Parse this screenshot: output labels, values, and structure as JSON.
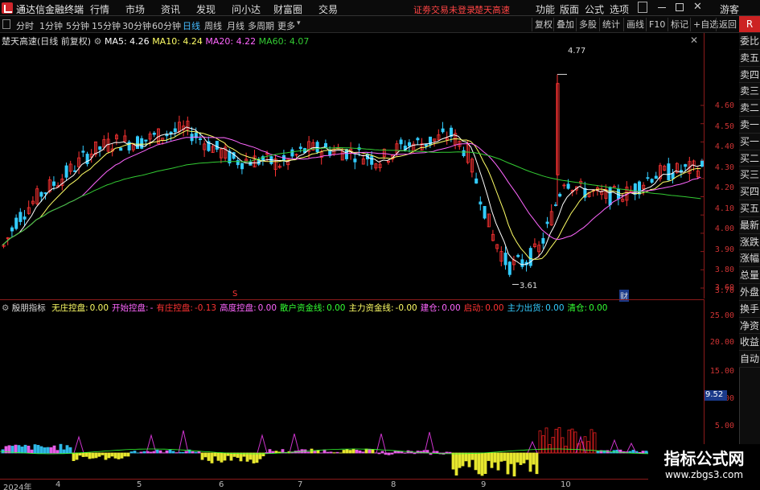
{
  "app": {
    "title": "通达信金融终端",
    "status_text": "证劵交易未登录",
    "stock_name_header": "楚天高速",
    "guest_label": "游客"
  },
  "menu": [
    "行情",
    "市场",
    "资讯",
    "发现",
    "问小达",
    "财富圈",
    "交易"
  ],
  "top_right_menu": [
    "功能",
    "版面",
    "公式",
    "选项"
  ],
  "periods": [
    "分时",
    "1分钟",
    "5分钟",
    "15分钟",
    "30分钟",
    "60分钟",
    "日线",
    "周线",
    "月线",
    "多周期",
    "更多"
  ],
  "active_period": "日线",
  "toolbar_right": [
    "复权",
    "叠加",
    "多股",
    "统计",
    "画线",
    "F10",
    "标记",
    "+自选",
    "返回"
  ],
  "main_legend": {
    "title": "楚天高速(日线 前复权)",
    "ma5": "MA5: 4.26",
    "ma10": "MA10: 4.24",
    "ma20": "MA20: 4.22",
    "ma60": "MA60: 4.07"
  },
  "price_axis": [
    "4.60",
    "4.50",
    "4.40",
    "4.30",
    "4.20",
    "4.10",
    "4.00",
    "3.90",
    "3.80",
    "3.70",
    "3.60"
  ],
  "annotations": {
    "high": "4.77",
    "low": "3.61",
    "marker_s": "S",
    "marker_cai": "财"
  },
  "indicator_legend": {
    "name": "殷朋指标",
    "items": [
      {
        "label": "无庄控盘:",
        "value": "0.00",
        "color": "#ffff66"
      },
      {
        "label": "开始控盘:",
        "value": "-",
        "color": "#ff66ff"
      },
      {
        "label": "有庄控盘:",
        "value": "-0.13",
        "color": "#ff3333"
      },
      {
        "label": "高度控盘:",
        "value": "0.00",
        "color": "#ff66ff"
      },
      {
        "label": "散户资金线:",
        "value": "0.00",
        "color": "#33ff33"
      },
      {
        "label": "主力资金线:",
        "value": "-0.00",
        "color": "#ffff66"
      },
      {
        "label": "建仓:",
        "value": "0.00",
        "color": "#ff66ff"
      },
      {
        "label": "启动:",
        "value": "0.00",
        "color": "#ff3333"
      },
      {
        "label": "主力出货:",
        "value": "0.00",
        "color": "#33ccff"
      },
      {
        "label": "清仓:",
        "value": "0.00",
        "color": "#33ff33"
      }
    ]
  },
  "indicator_axis": [
    "25.00",
    "20.00",
    "15.00",
    "10.00",
    "5.00"
  ],
  "indicator_current": "9.52",
  "x_axis": [
    "2024年",
    "4",
    "5",
    "6",
    "7",
    "8",
    "9",
    "10"
  ],
  "side_panel": [
    "委比",
    "卖五",
    "卖四",
    "卖三",
    "卖二",
    "卖一",
    "买一",
    "买二",
    "买三",
    "买四",
    "买五",
    "最新",
    "涨跌",
    "涨幅",
    "总量",
    "外盘",
    "换手",
    "净资",
    "收益",
    "自动"
  ],
  "watermark": {
    "line1": "指标公式网",
    "line2": "www.zbgs3.com"
  },
  "colors": {
    "up": "#ff3333",
    "down": "#33ccff",
    "ma5": "#ffffff",
    "ma10": "#ffff66",
    "ma20": "#ff66ff",
    "ma60": "#33cc33"
  }
}
